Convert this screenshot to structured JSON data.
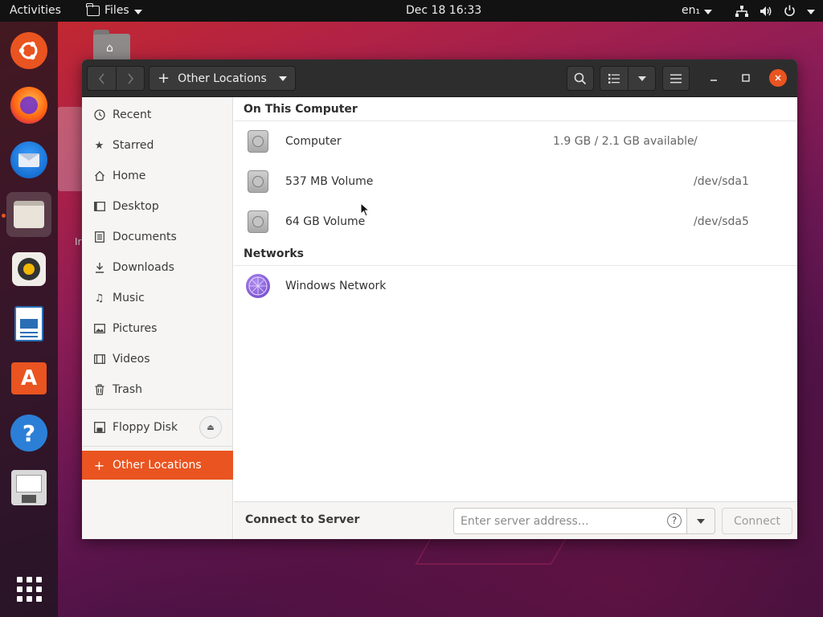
{
  "topbar": {
    "activities": "Activities",
    "app_menu": "Files",
    "clock": "Dec 18  16:33",
    "language": "en₁"
  },
  "dock": {
    "apps": [
      "ubuntu-icon",
      "firefox-icon",
      "thunderbird-icon",
      "files-icon",
      "rhythmbox-icon",
      "libreoffice-writer-icon",
      "software-center-icon",
      "help-icon",
      "text-editor-icon",
      "show-apps-icon"
    ],
    "accent": "#e95420"
  },
  "window": {
    "location_button": "Other Locations",
    "close_color": "#e95420"
  },
  "sidebar": {
    "items": [
      {
        "label": "Recent",
        "icon": "clock-icon"
      },
      {
        "label": "Starred",
        "icon": "star-icon"
      },
      {
        "label": "Home",
        "icon": "home-icon"
      },
      {
        "label": "Desktop",
        "icon": "desktop-icon"
      },
      {
        "label": "Documents",
        "icon": "document-icon"
      },
      {
        "label": "Downloads",
        "icon": "download-icon"
      },
      {
        "label": "Music",
        "icon": "music-icon"
      },
      {
        "label": "Pictures",
        "icon": "picture-icon"
      },
      {
        "label": "Videos",
        "icon": "video-icon"
      },
      {
        "label": "Trash",
        "icon": "trash-icon"
      }
    ],
    "device": {
      "label": "Floppy Disk",
      "icon": "floppy-icon"
    },
    "other_locations": "Other Locations"
  },
  "main": {
    "on_this_computer": "On This Computer",
    "networks": "Networks",
    "computer_rows": [
      {
        "name": "Computer",
        "avail": "1.9 GB / 2.1 GB available",
        "path": "/"
      },
      {
        "name": "537 MB Volume",
        "avail": "",
        "path": "/dev/sda1"
      },
      {
        "name": "64 GB Volume",
        "avail": "",
        "path": "/dev/sda5"
      }
    ],
    "network_rows": [
      {
        "name": "Windows Network"
      }
    ]
  },
  "connect": {
    "label": "Connect to Server",
    "placeholder": "Enter server address…",
    "button": "Connect"
  }
}
